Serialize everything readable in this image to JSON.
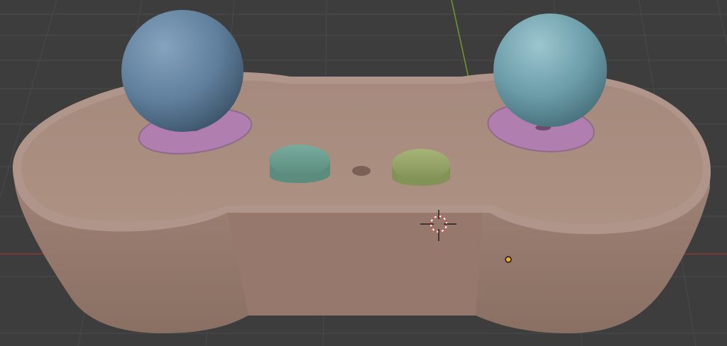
{
  "app": {
    "name": "3D viewport"
  },
  "viewport": {
    "background": "#3d3d3d",
    "grid_color": "#4a4a4a",
    "axis_x_color": "#8a3a3a",
    "axis_y_color": "#6f9a2e"
  },
  "scene": {
    "objects": [
      {
        "name": "controller-body",
        "color": "#a88a7c"
      },
      {
        "name": "joystick-left",
        "color": "#6b8aa6"
      },
      {
        "name": "joystick-right",
        "color": "#7aa7b3"
      },
      {
        "name": "stick-pad-left",
        "color": "#b07fb0"
      },
      {
        "name": "stick-pad-right",
        "color": "#b07fb0"
      },
      {
        "name": "button-teal",
        "color": "#6fa394"
      },
      {
        "name": "button-green",
        "color": "#9aa96b"
      }
    ],
    "cursor": {
      "icon": "3d-cursor-icon"
    },
    "origin": {
      "icon": "object-origin-dot-icon",
      "color": "#f5a623"
    }
  }
}
